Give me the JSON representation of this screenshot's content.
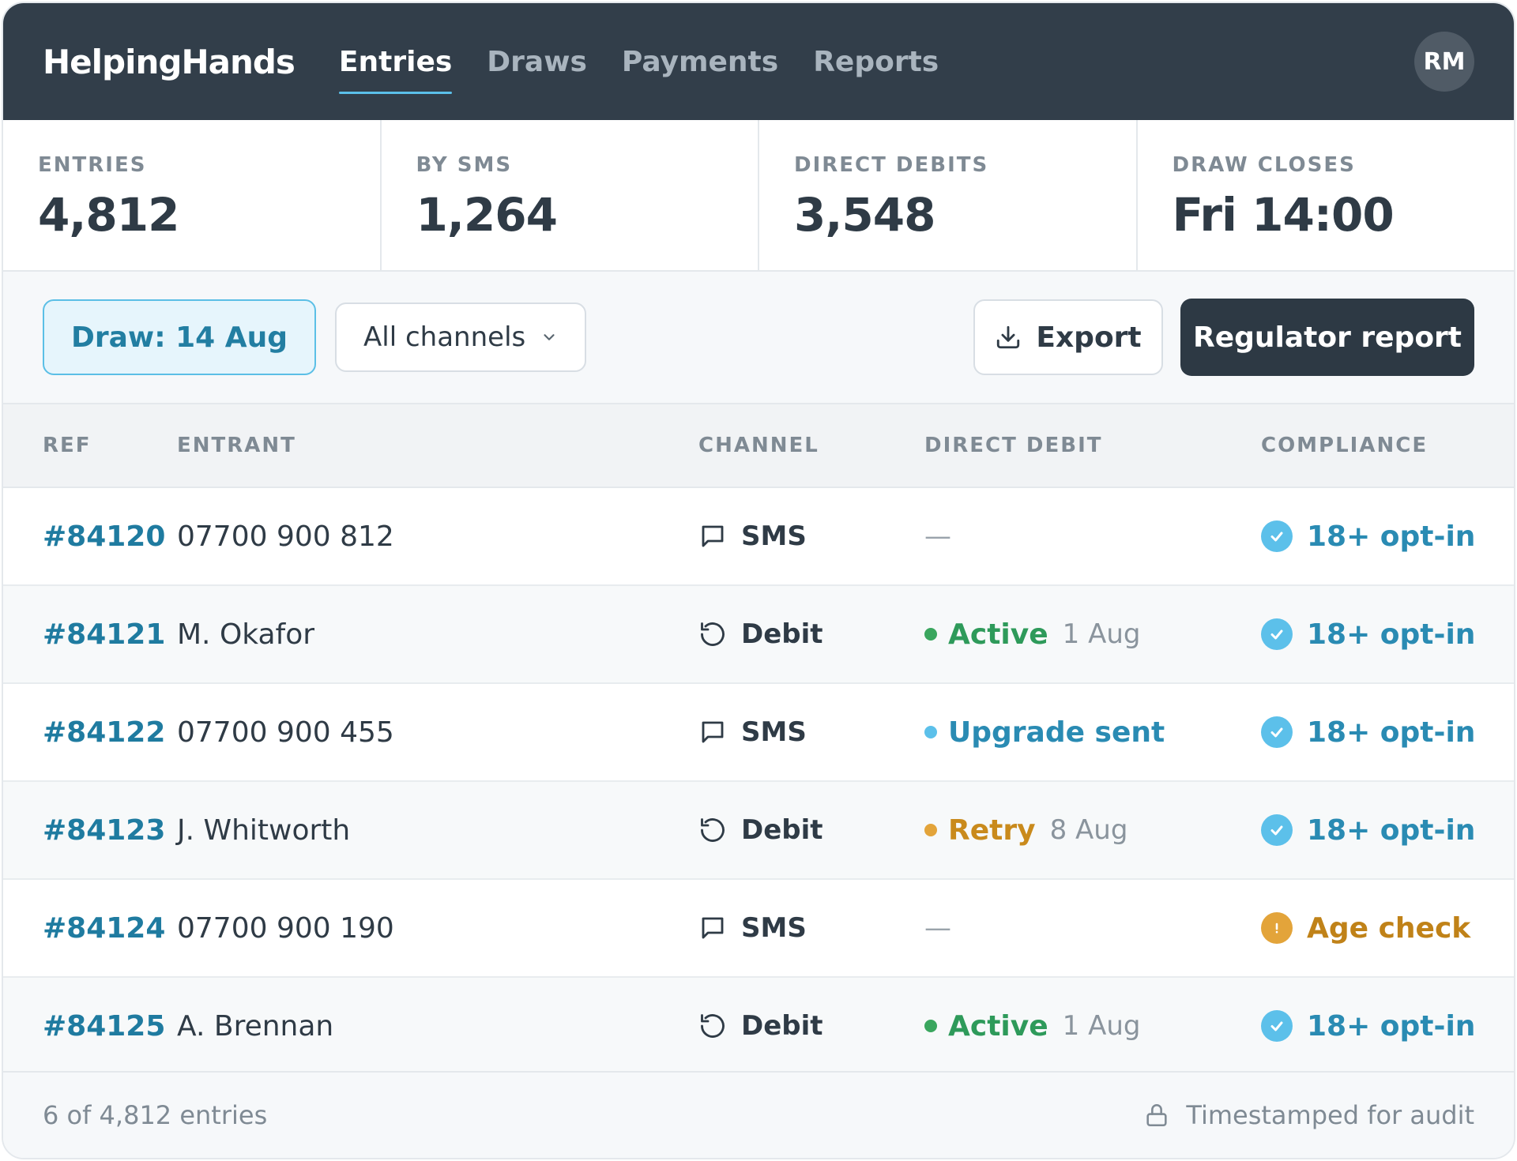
{
  "app": {
    "brand": "HelpingHands",
    "avatar_initials": "RM"
  },
  "nav": {
    "tabs": [
      {
        "label": "Entries",
        "active": true
      },
      {
        "label": "Draws",
        "active": false
      },
      {
        "label": "Payments",
        "active": false
      },
      {
        "label": "Reports",
        "active": false
      }
    ]
  },
  "stats": [
    {
      "label": "ENTRIES",
      "value": "4,812"
    },
    {
      "label": "BY SMS",
      "value": "1,264"
    },
    {
      "label": "DIRECT DEBITS",
      "value": "3,548"
    },
    {
      "label": "DRAW CLOSES",
      "value": "Fri 14:00"
    }
  ],
  "toolbar": {
    "draw_chip": "Draw: 14 Aug",
    "channel_select": "All channels",
    "export_label": "Export",
    "report_label": "Regulator report"
  },
  "table": {
    "headers": {
      "ref": "REF",
      "entrant": "ENTRANT",
      "channel": "CHANNEL",
      "direct_debit": "DIRECT DEBIT",
      "compliance": "COMPLIANCE"
    },
    "rows": [
      {
        "ref": "#84120",
        "entrant": "07700 900 812",
        "channel": "SMS",
        "channel_icon": "message-icon",
        "dd_status": "",
        "dd_date": "",
        "dd_color": "",
        "compliance": "18+ opt-in",
        "compliance_type": "ok"
      },
      {
        "ref": "#84121",
        "entrant": "M. Okafor",
        "channel": "Debit",
        "channel_icon": "recurring-icon",
        "dd_status": "Active",
        "dd_date": "1 Aug",
        "dd_color": "#2e9a5a",
        "compliance": "18+ opt-in",
        "compliance_type": "ok"
      },
      {
        "ref": "#84122",
        "entrant": "07700 900 455",
        "channel": "SMS",
        "channel_icon": "message-icon",
        "dd_status": "Upgrade sent",
        "dd_date": "",
        "dd_color": "#2a8bb3",
        "compliance": "18+ opt-in",
        "compliance_type": "ok"
      },
      {
        "ref": "#84123",
        "entrant": "J. Whitworth",
        "channel": "Debit",
        "channel_icon": "recurring-icon",
        "dd_status": "Retry",
        "dd_date": "8 Aug",
        "dd_color": "#c98a1c",
        "compliance": "18+ opt-in",
        "compliance_type": "ok"
      },
      {
        "ref": "#84124",
        "entrant": "07700 900 190",
        "channel": "SMS",
        "channel_icon": "message-icon",
        "dd_status": "",
        "dd_date": "",
        "dd_color": "",
        "compliance": "Age check",
        "compliance_type": "warn"
      },
      {
        "ref": "#84125",
        "entrant": "A. Brennan",
        "channel": "Debit",
        "channel_icon": "recurring-icon",
        "dd_status": "Active",
        "dd_date": "1 Aug",
        "dd_color": "#2e9a5a",
        "compliance": "18+ opt-in",
        "compliance_type": "ok"
      }
    ],
    "empty_dd": "—"
  },
  "footer": {
    "count_text": "6 of 4,812 entries",
    "audit_text": "Timestamped for audit"
  },
  "colors": {
    "header_bg": "#323e4a",
    "accent": "#5bc0ea",
    "ref_link": "#1f7ba0",
    "compliance_ok": "#2a8bb3",
    "compliance_ok_icon": "#5cc0ea",
    "compliance_warn": "#c08218",
    "compliance_warn_icon": "#e3a43a",
    "dd_active_dot": "#3aa65e",
    "dd_upgrade_dot": "#5cc0ea",
    "dd_retry_dot": "#e3a43a"
  }
}
